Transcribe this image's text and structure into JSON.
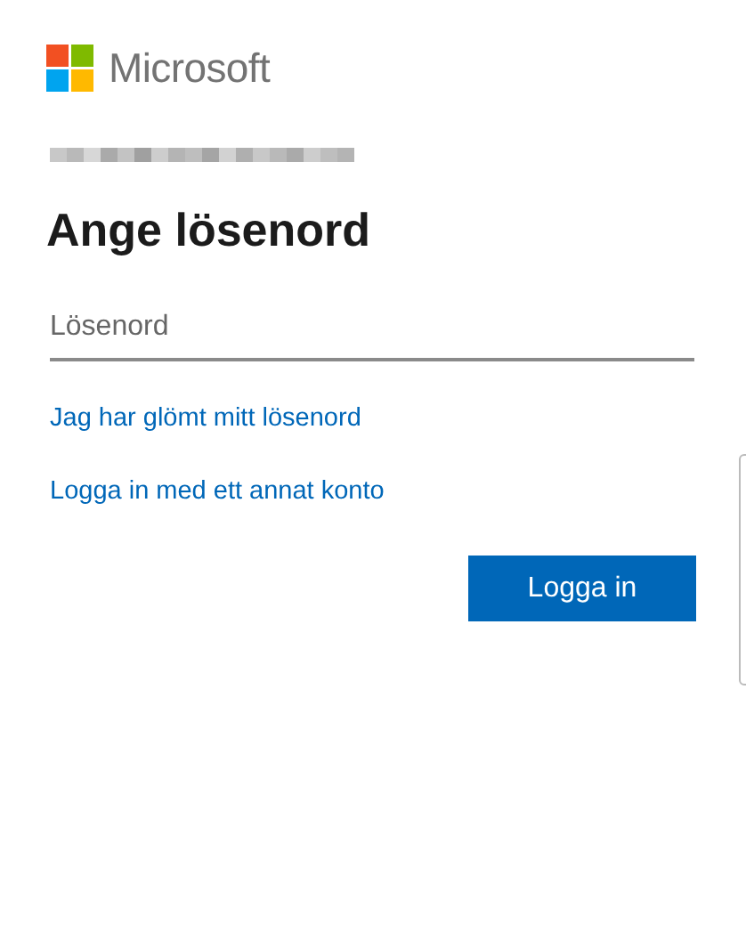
{
  "logo": {
    "text": "Microsoft"
  },
  "heading": "Ange lösenord",
  "password_field": {
    "placeholder": "Lösenord"
  },
  "links": [
    "Jag har glömt mitt lösenord",
    "Logga in med ett annat konto"
  ],
  "buttons": [
    "Logga in"
  ]
}
